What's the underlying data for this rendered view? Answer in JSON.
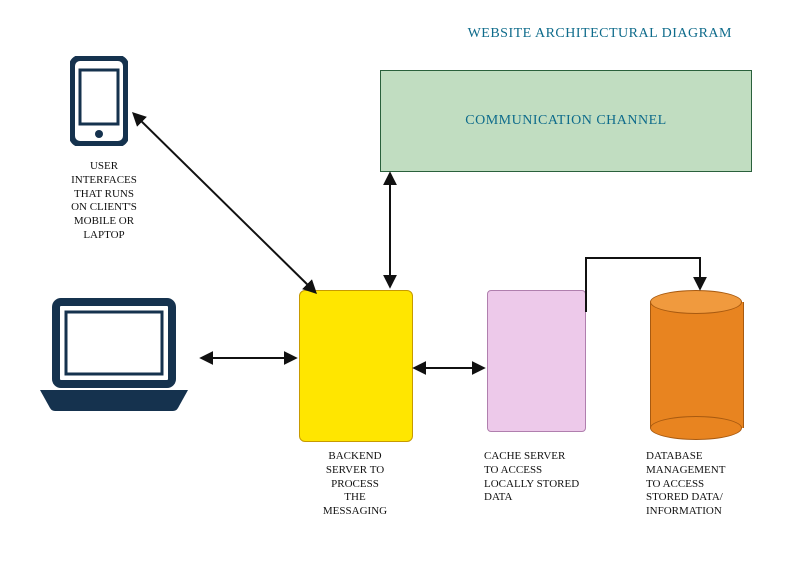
{
  "title": "WEBSITE ARCHITECTURAL DIAGRAM",
  "nodes": {
    "user_interfaces": {
      "label": "USER\nINTERFACES\nTHAT RUNS\nON CLIENT'S\nMOBILE OR\nLAPTOP"
    },
    "communication_channel": {
      "label": "COMMUNICATION CHANNEL"
    },
    "backend": {
      "label": "BACKEND\nSERVER TO\nPROCESS\nTHE\nMESSAGING"
    },
    "cache": {
      "label": "CACHE SERVER\nTO ACCESS\nLOCALLY STORED\nDATA"
    },
    "database": {
      "label": "DATABASE\nMANAGEMENT\nTO ACCESS\nSTORED DATA/\nINFORMATION"
    }
  },
  "colors": {
    "title": "#0e6b8b",
    "comm_bg": "#c1ddc1",
    "backend_bg": "#ffe600",
    "cache_bg": "#edc9ea",
    "db_bg": "#e88420",
    "icon": "#15324e"
  }
}
